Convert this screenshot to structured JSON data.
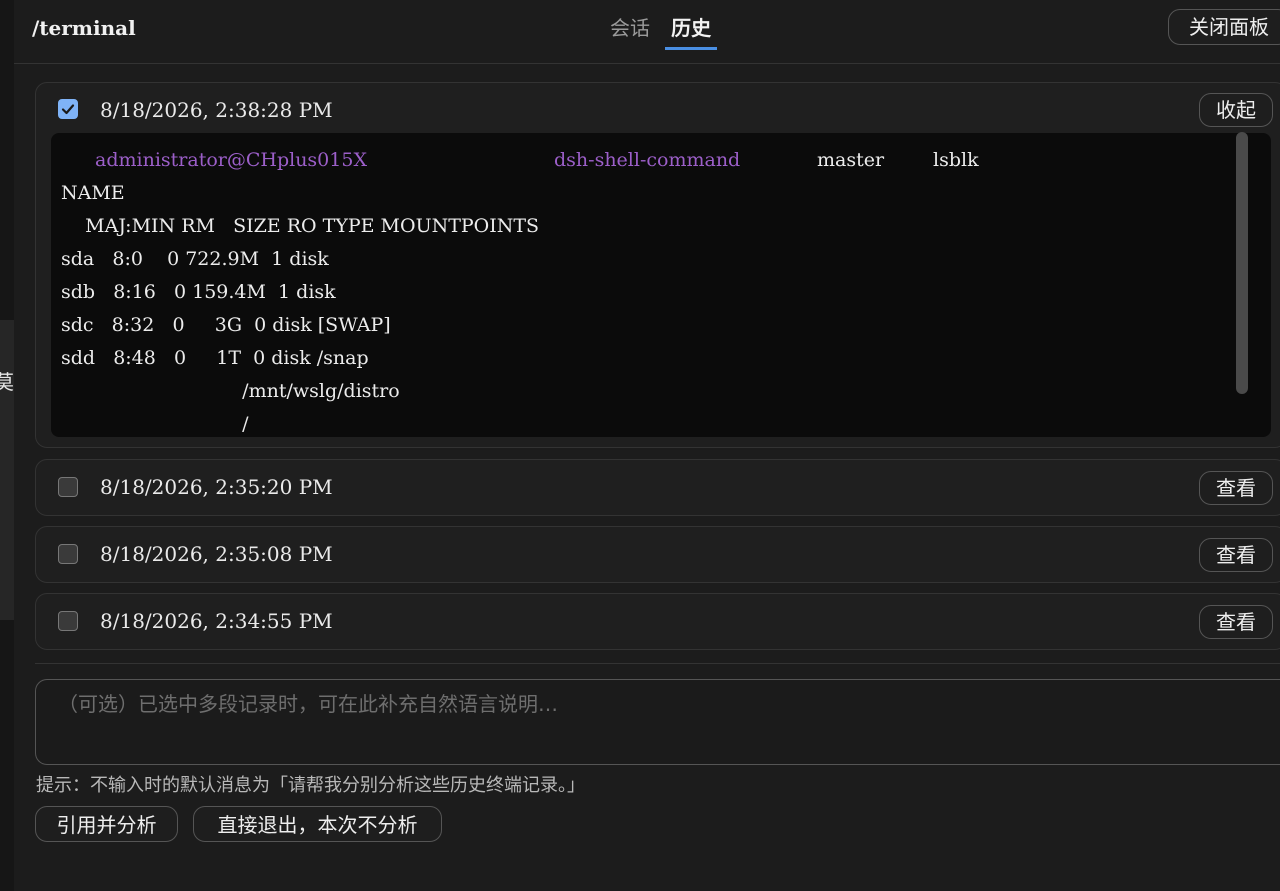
{
  "left_strip": {
    "char": "莫"
  },
  "header": {
    "title": "/terminal",
    "tabs": [
      {
        "label": "会话",
        "active": false
      },
      {
        "label": "历史",
        "active": true
      }
    ],
    "close_label": "关闭面板"
  },
  "history": [
    {
      "timestamp": "8/18/2026, 2:38:28 PM",
      "checked": true,
      "action_label": "收起",
      "expanded": true,
      "terminal": {
        "prompt_user": "administrator@CHplus015X",
        "prompt_dir": "dsh-shell-command",
        "prompt_branch": "master",
        "command": "lsblk",
        "output": [
          "NAME",
          "    MAJ:MIN RM   SIZE RO TYPE MOUNTPOINTS",
          "sda   8:0    0 722.9M  1 disk",
          "sdb   8:16   0 159.4M  1 disk",
          "sdc   8:32   0     3G  0 disk [SWAP]",
          "sdd   8:48   0     1T  0 disk /snap",
          "                              /mnt/wslg/distro",
          "                              /"
        ]
      }
    },
    {
      "timestamp": "8/18/2026, 2:35:20 PM",
      "checked": false,
      "action_label": "查看"
    },
    {
      "timestamp": "8/18/2026, 2:35:08 PM",
      "checked": false,
      "action_label": "查看"
    },
    {
      "timestamp": "8/18/2026, 2:34:55 PM",
      "checked": false,
      "action_label": "查看"
    }
  ],
  "note": {
    "placeholder": "（可选）已选中多段记录时，可在此补充自然语言说明…",
    "value": ""
  },
  "hint": "提示：不输入时的默认消息为「请帮我分别分析这些历史终端记录。」",
  "buttons": {
    "analyze_label": "引用并分析",
    "exit_label": "直接退出，本次不分析"
  },
  "colors": {
    "accent": "#4a8fe3",
    "checkbox_checked": "#7fb3f7",
    "prompt_purple": "#9c5fc9",
    "terminal_bg": "#0b0b0b"
  }
}
